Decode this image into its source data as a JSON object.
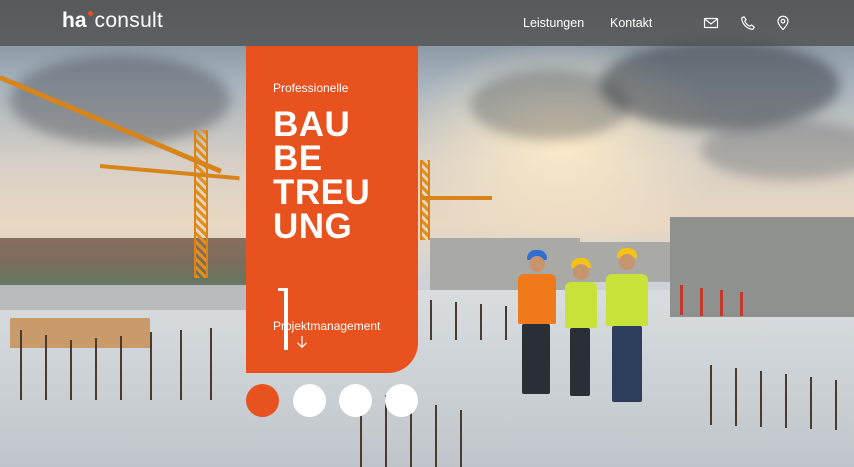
{
  "header": {
    "logo_bold": "ha",
    "logo_light": "consult",
    "nav": [
      {
        "label": "Leistungen"
      },
      {
        "label": "Kontakt"
      }
    ],
    "icons": [
      "mail-icon",
      "phone-icon",
      "location-pin-icon"
    ]
  },
  "hero": {
    "eyebrow": "Professionelle",
    "headline_lines": [
      "BAU",
      "BE",
      "TREU",
      "UNG"
    ],
    "service_link": "Projektmanagement",
    "arrow_icon": "arrow-down-icon"
  },
  "slider": {
    "slide_count": 4,
    "active_index": 0
  },
  "colors": {
    "accent": "#e8521f",
    "header_bg": "#505050",
    "text_on_accent": "#ffffff"
  }
}
